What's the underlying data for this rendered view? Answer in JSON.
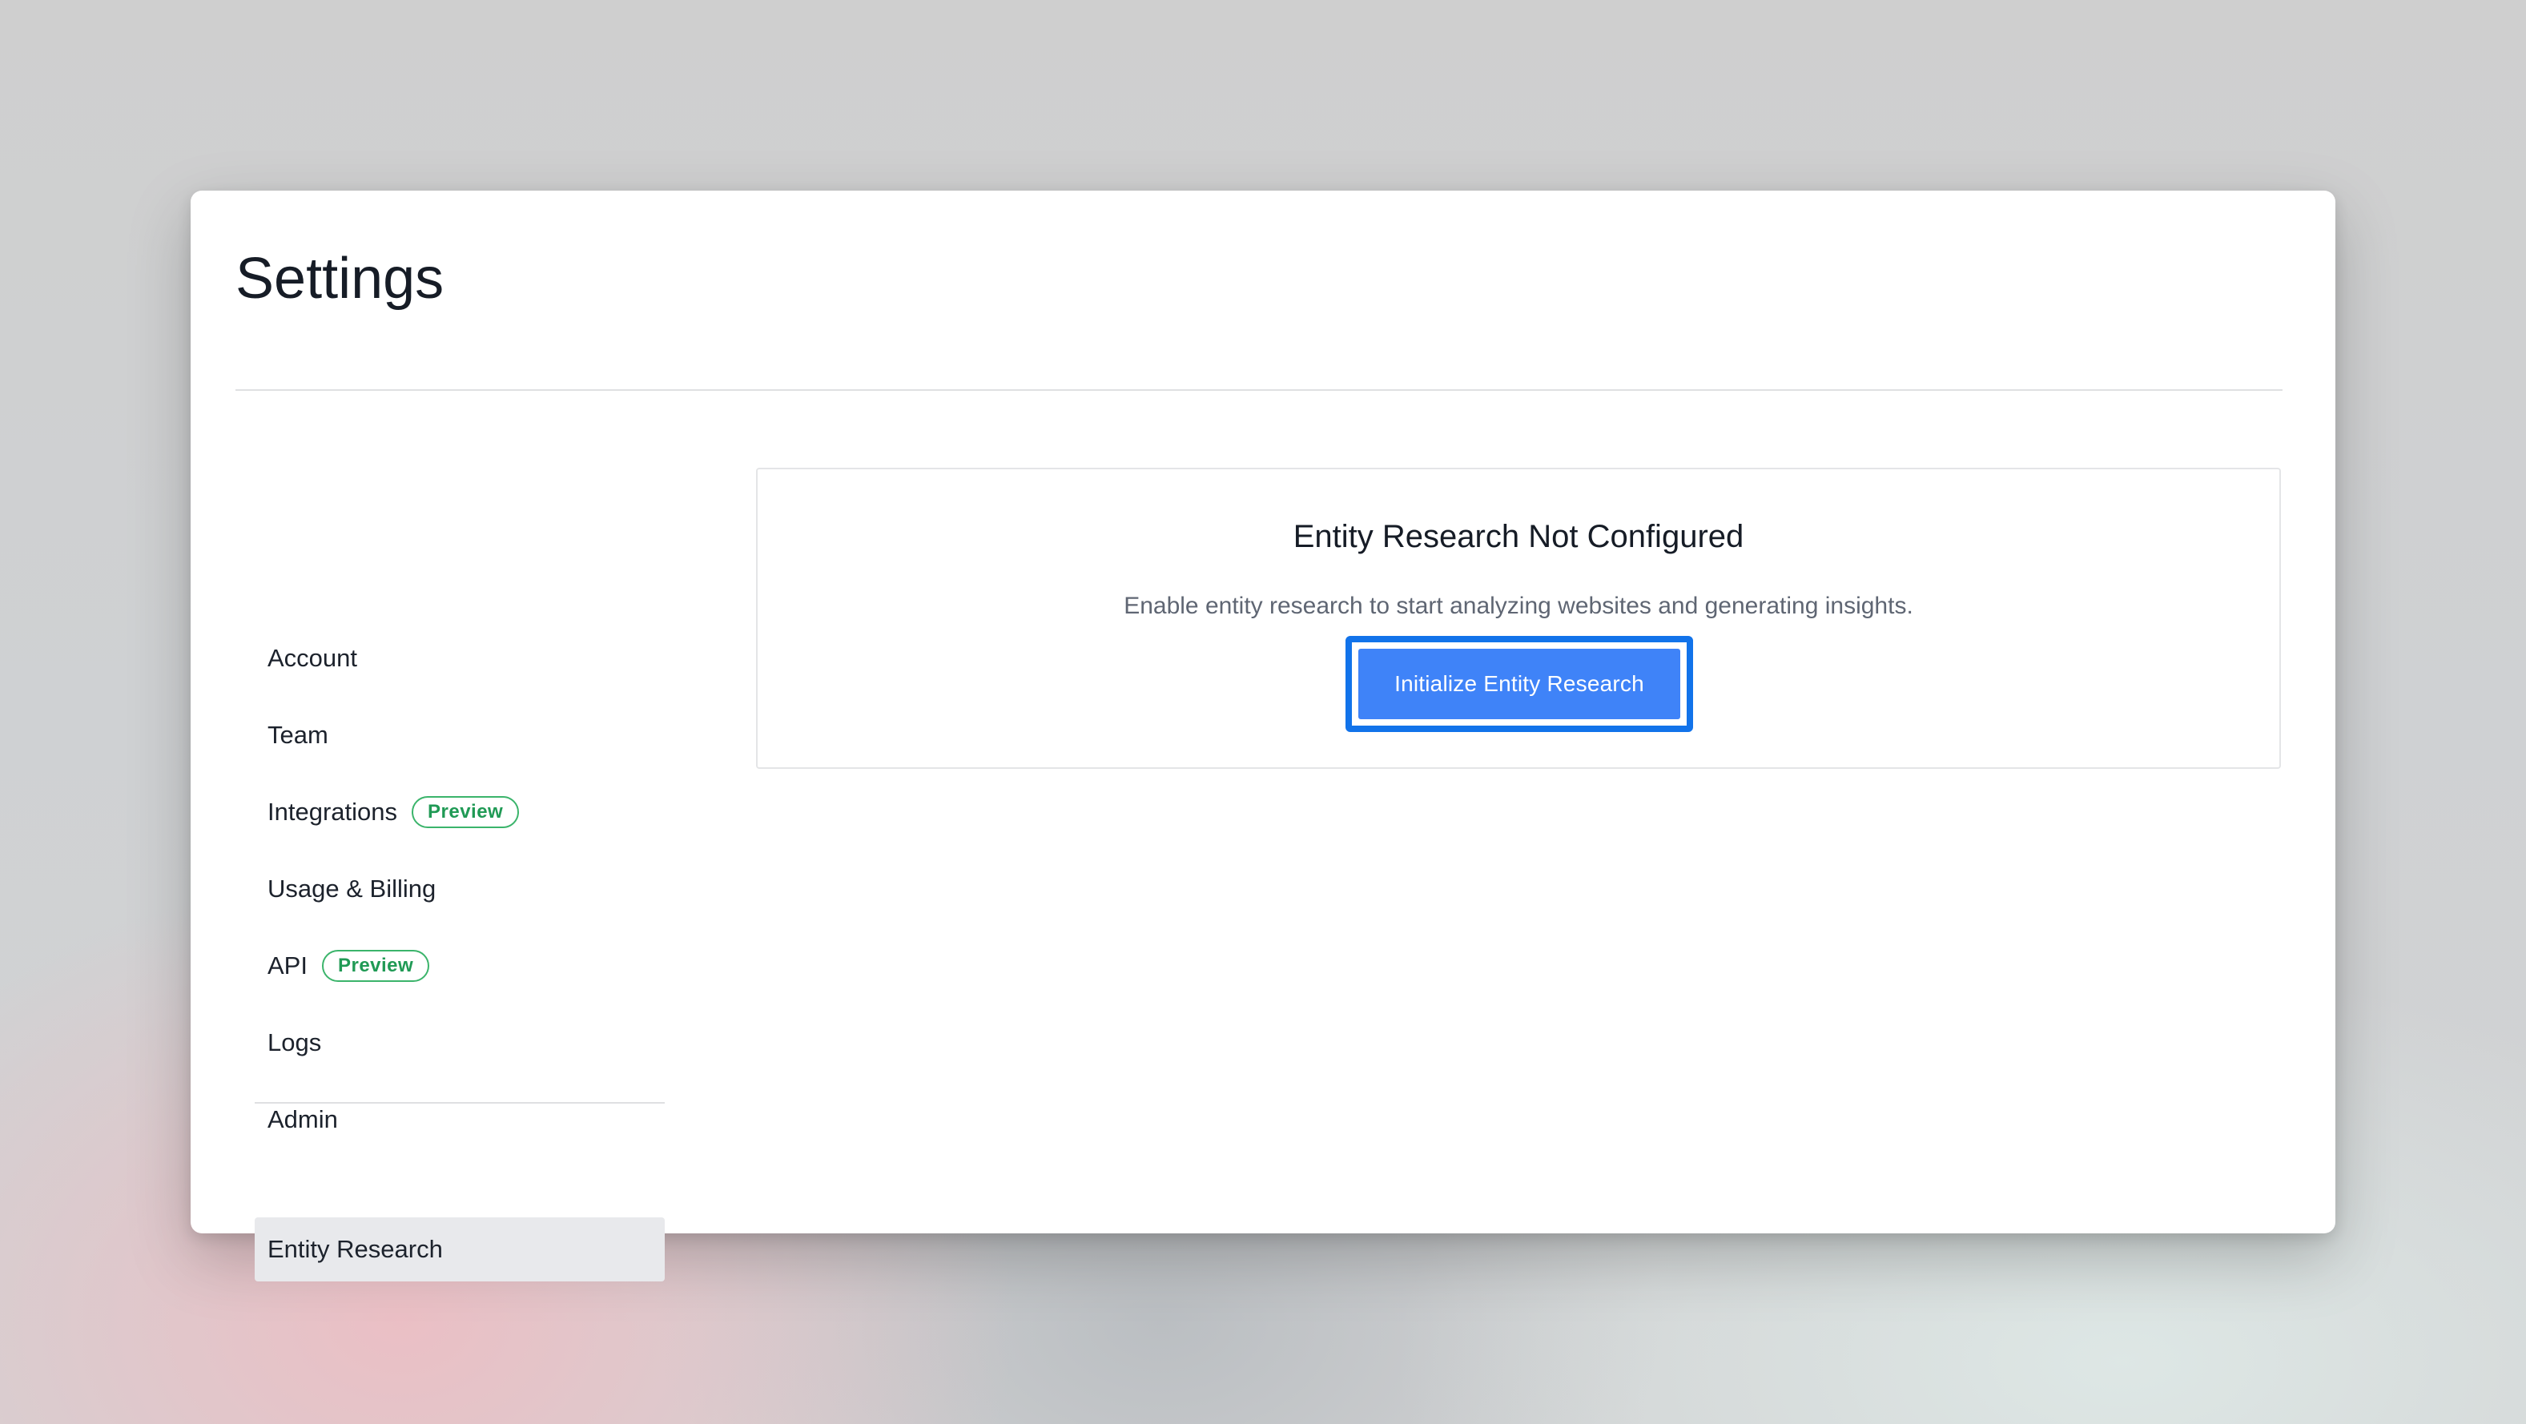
{
  "page": {
    "title": "Settings"
  },
  "sidebar": {
    "items": [
      {
        "label": "Account",
        "badge": null,
        "active": false
      },
      {
        "label": "Team",
        "badge": null,
        "active": false
      },
      {
        "label": "Integrations",
        "badge": "Preview",
        "active": false
      },
      {
        "label": "Usage & Billing",
        "badge": null,
        "active": false
      },
      {
        "label": "API",
        "badge": "Preview",
        "active": false
      },
      {
        "label": "Logs",
        "badge": null,
        "active": false
      },
      {
        "label": "Admin",
        "badge": null,
        "active": false
      },
      {
        "label": "Entity Research",
        "badge": null,
        "active": true
      }
    ]
  },
  "main": {
    "card": {
      "title": "Entity Research Not Configured",
      "description": "Enable entity research to start analyzing websites and generating insights.",
      "button_label": "Initialize Entity Research"
    }
  },
  "colors": {
    "accent": "#3f83f8",
    "focus_ring": "#1273ea",
    "badge_green": "#209a55",
    "active_nav_bg": "#e8e9ec"
  }
}
